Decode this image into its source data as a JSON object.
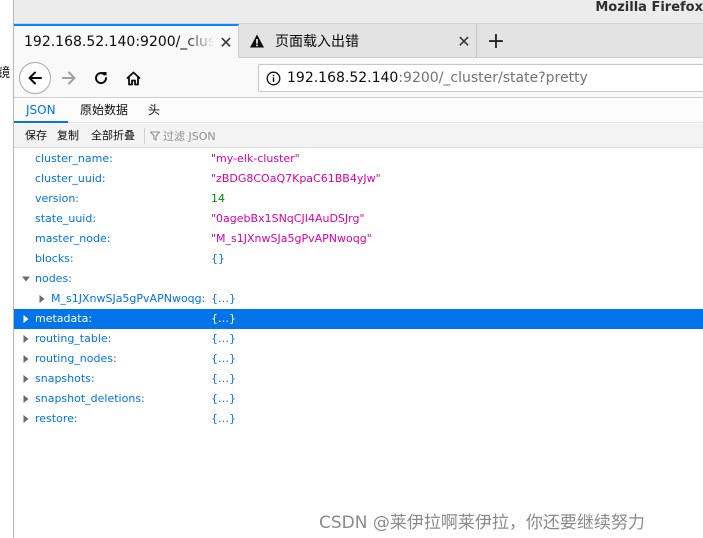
{
  "window": {
    "title": "Mozilla Firefox",
    "left_clip_text": "镜"
  },
  "tabs": [
    {
      "label": "192.168.52.140:9200/_cluster/state?pretty",
      "active": true,
      "close": "✕"
    },
    {
      "label": "页面载入出错",
      "active": false,
      "icon": "warning-icon",
      "close": "✕"
    }
  ],
  "new_tab_label": "+",
  "navigation": {
    "back_icon": "back-arrow-icon",
    "forward_icon": "forward-arrow-icon",
    "reload_icon": "reload-icon",
    "home_icon": "home-icon"
  },
  "url": {
    "info_icon": "info-icon",
    "host": "192.168.52.140",
    "rest": ":9200/_cluster/state?pretty"
  },
  "viewer": {
    "tabs": [
      "JSON",
      "原始数据",
      "头"
    ],
    "active_tab": "JSON",
    "toolbar": {
      "save": "保存",
      "copy": "复制",
      "collapse_all": "全部折叠",
      "filter_placeholder": "过滤 JSON",
      "filter_icon": "filter-icon"
    }
  },
  "tree": [
    {
      "key": "cluster_name:",
      "value": "\"my-elk-cluster\"",
      "type": "string"
    },
    {
      "key": "cluster_uuid:",
      "value": "\"zBDG8COaQ7KpaC61BB4yJw\"",
      "type": "string"
    },
    {
      "key": "version:",
      "value": "14",
      "type": "number"
    },
    {
      "key": "state_uuid:",
      "value": "\"0agebBx1SNqCJI4AuDSJrg\"",
      "type": "string"
    },
    {
      "key": "master_node:",
      "value": "\"M_s1JXnwSJa5gPvAPNwoqg\"",
      "type": "string"
    },
    {
      "key": "blocks:",
      "value": "{}",
      "type": "object"
    },
    {
      "key": "nodes:",
      "value": "",
      "type": "object",
      "expanded": true
    },
    {
      "key": "M_s1JXnwSJa5gPvAPNwoqg:",
      "value": "{…}",
      "type": "object",
      "expanded": false,
      "indent": 1
    },
    {
      "key": "metadata:",
      "value": "{…}",
      "type": "object",
      "expanded": false,
      "selected": true
    },
    {
      "key": "routing_table:",
      "value": "{…}",
      "type": "object",
      "expanded": false
    },
    {
      "key": "routing_nodes:",
      "value": "{…}",
      "type": "object",
      "expanded": false
    },
    {
      "key": "snapshots:",
      "value": "{…}",
      "type": "object",
      "expanded": false
    },
    {
      "key": "snapshot_deletions:",
      "value": "{…}",
      "type": "object",
      "expanded": false
    },
    {
      "key": "restore:",
      "value": "{…}",
      "type": "object",
      "expanded": false
    }
  ],
  "watermark": "CSDN @莱伊拉啊莱伊拉，你还要继续努力",
  "colors": {
    "accent": "#0074e8",
    "string": "#dd00a9",
    "number": "#058b00",
    "selected_bg": "#0074e8"
  }
}
